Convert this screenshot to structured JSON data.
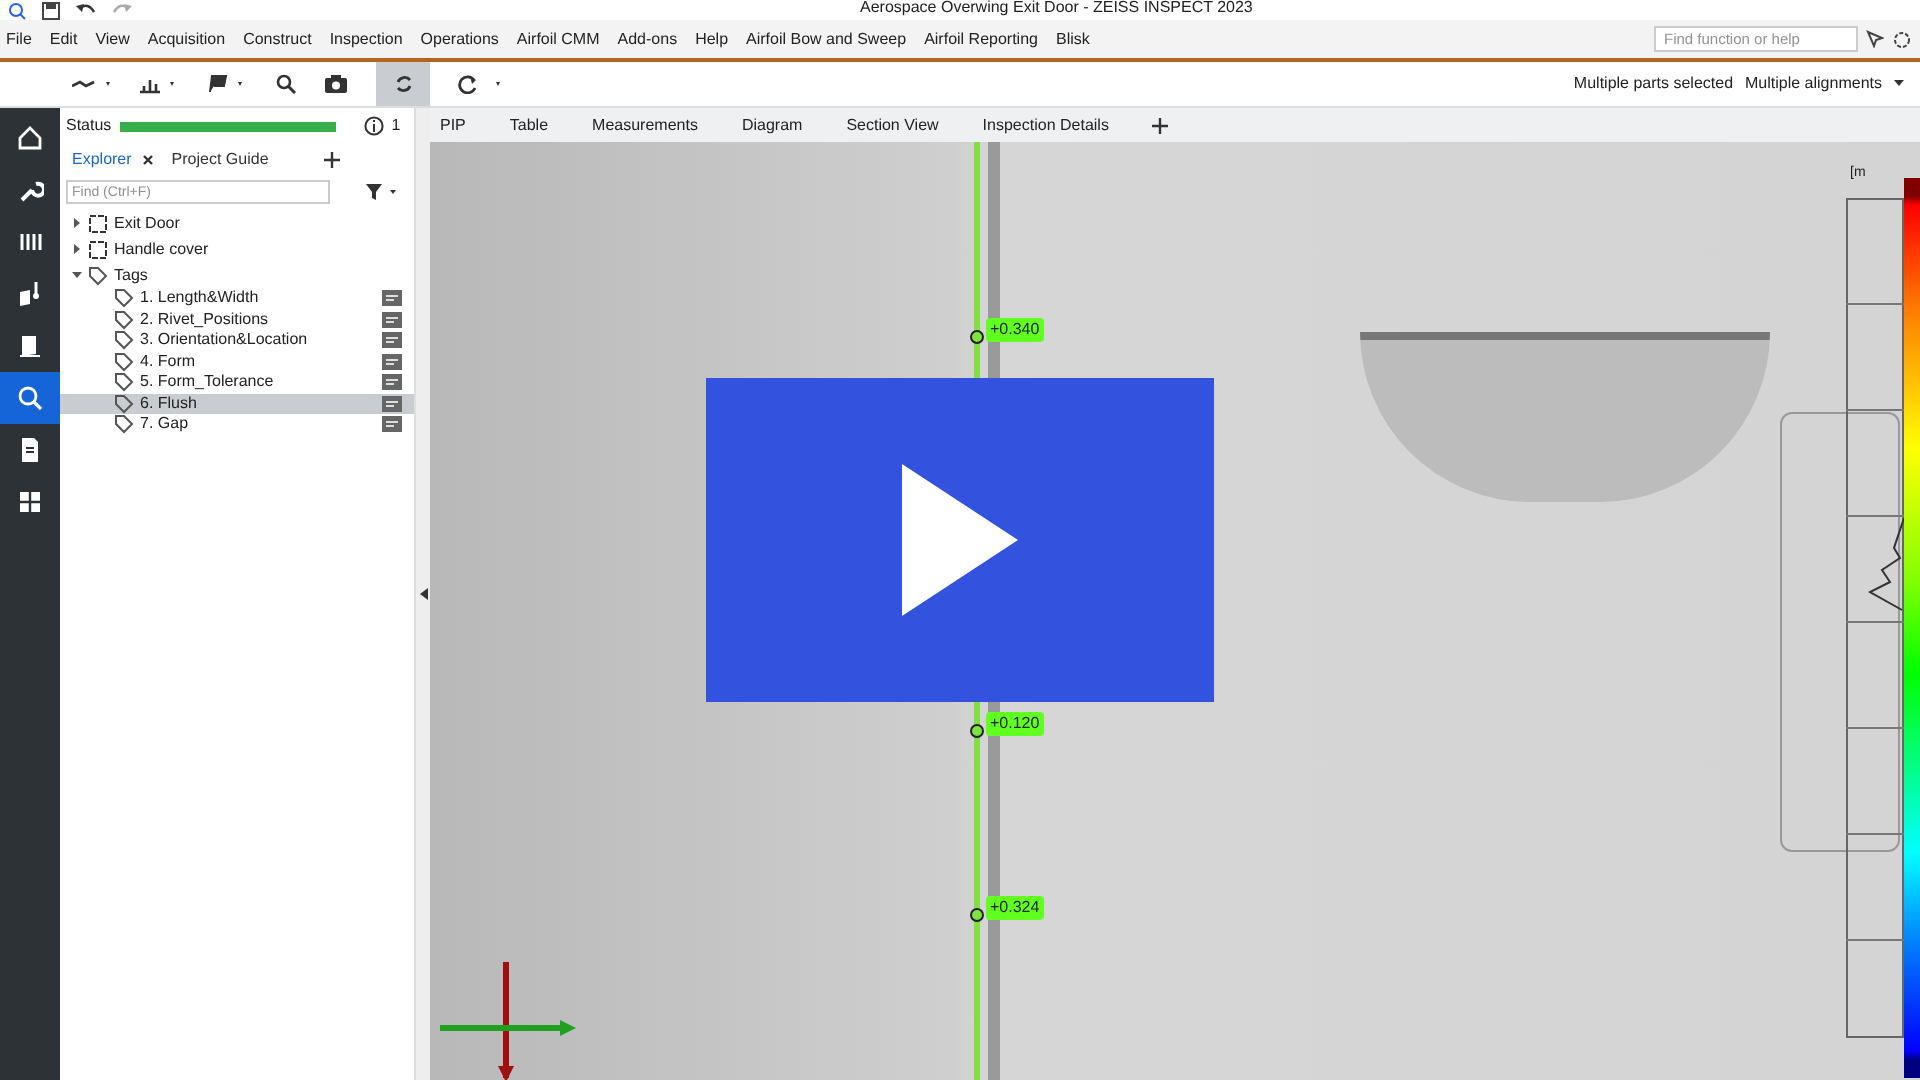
{
  "window": {
    "title": "Aerospace Overwing Exit Door - ZEISS INSPECT 2023"
  },
  "menu": [
    "File",
    "Edit",
    "View",
    "Acquisition",
    "Construct",
    "Inspection",
    "Operations",
    "Airfoil CMM",
    "Add-ons",
    "Help",
    "Airfoil Bow and Sweep",
    "Airfoil Reporting",
    "Blisk"
  ],
  "search": {
    "placeholder": "Find function or help"
  },
  "toolbar": {
    "parts": "Multiple parts selected",
    "alignments": "Multiple alignments"
  },
  "sidebar": {
    "items": [
      {
        "kind": "home",
        "selected": false
      },
      {
        "kind": "wrench",
        "selected": false
      },
      {
        "kind": "bars",
        "selected": false
      },
      {
        "kind": "probe",
        "selected": false
      },
      {
        "kind": "part",
        "selected": false
      },
      {
        "kind": "search",
        "selected": true
      },
      {
        "kind": "doc",
        "selected": false
      },
      {
        "kind": "grid",
        "selected": false
      }
    ]
  },
  "status": {
    "label": "Status",
    "level": 1,
    "count": "1"
  },
  "explorer": {
    "tabs": [
      {
        "label": "Explorer",
        "selected": true
      },
      {
        "label": "Project Guide",
        "selected": false
      }
    ],
    "find_placeholder": "Find (Ctrl+F)",
    "tree": [
      {
        "label": "Exit Door",
        "kind": "part",
        "expanded": false
      },
      {
        "label": "Handle cover",
        "kind": "part",
        "expanded": false
      },
      {
        "label": "Tags",
        "kind": "tag",
        "expanded": true,
        "children": [
          {
            "label": "1. Length&Width",
            "selected": false
          },
          {
            "label": "2. Rivet_Positions",
            "selected": false
          },
          {
            "label": "3. Orientation&Location",
            "selected": false
          },
          {
            "label": "4. Form",
            "selected": false
          },
          {
            "label": "5. Form_Tolerance",
            "selected": false
          },
          {
            "label": "6. Flush",
            "selected": true
          },
          {
            "label": "7. Gap",
            "selected": false
          }
        ]
      }
    ]
  },
  "view_tabs": [
    "PIP",
    "Table",
    "Measurements",
    "Diagram",
    "Section View",
    "Inspection Details"
  ],
  "viewport": {
    "labels": [
      "+0.340",
      "+0.120",
      "+0.324"
    ],
    "unit": "[m"
  }
}
